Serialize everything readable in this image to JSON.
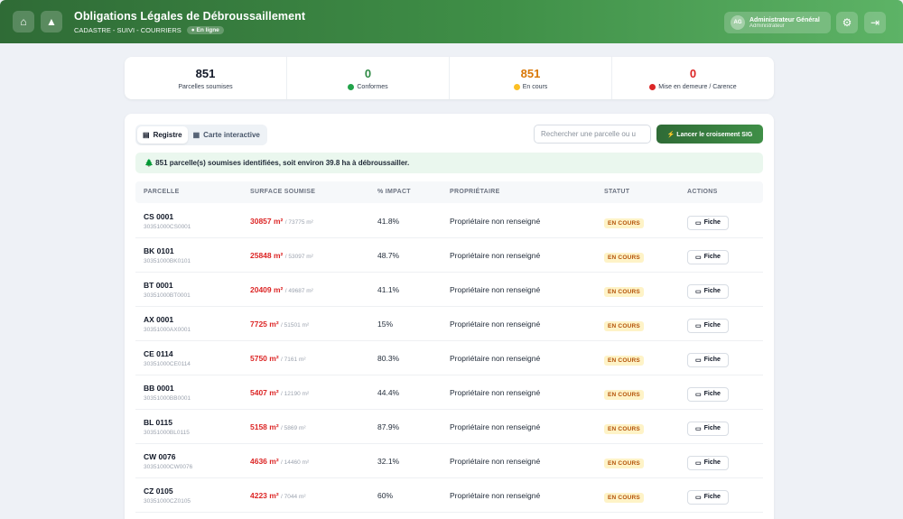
{
  "header": {
    "title": "Obligations Légales de Débroussaillement",
    "subtitle": "CADASTRE - SUIVI - COURRIERS",
    "status": "● En ligne",
    "user_initials": "AG",
    "user_name": "Administrateur Général",
    "user_role": "Administrateur",
    "icons": [
      "home-icon",
      "tree-icon",
      "gear-icon",
      "logout-icon"
    ]
  },
  "stats": [
    {
      "value": "851",
      "label": "Parcelles soumises",
      "color": "#111827",
      "dot": ""
    },
    {
      "value": "0",
      "label": "Conformes",
      "color": "#2f8a45",
      "dot": "#22a34a"
    },
    {
      "value": "851",
      "label": "En cours",
      "color": "#d97706",
      "dot": "#fbbf24"
    },
    {
      "value": "0",
      "label": "Mise en demeure / Carence",
      "color": "#dc2626",
      "dot": "#dc2626"
    }
  ],
  "tabs": {
    "registre": "Registre",
    "carte": "Carte interactive"
  },
  "search": {
    "placeholder": "Rechercher une parcelle ou u"
  },
  "launch_label": "⚡ Lancer le croisement SIG",
  "banner": "🌲 851 parcelle(s) soumises identifiées, soit environ 39.8 ha à débroussailler.",
  "table": {
    "headers": [
      "PARCELLE",
      "SURFACE SOUMISE",
      "% IMPACT",
      "PROPRIÉTAIRE",
      "STATUT",
      "ACTIONS"
    ],
    "rows": [
      {
        "code": "CS 0001",
        "id": "30351000CS0001",
        "surface": "30857 m²",
        "total": "/ 73775 m²",
        "impact": "41.8%",
        "owner": "Propriétaire non renseigné",
        "status": "EN COURS",
        "action": "Fiche"
      },
      {
        "code": "BK 0101",
        "id": "30351000BK0101",
        "surface": "25848 m²",
        "total": "/ 53097 m²",
        "impact": "48.7%",
        "owner": "Propriétaire non renseigné",
        "status": "EN COURS",
        "action": "Fiche"
      },
      {
        "code": "BT 0001",
        "id": "30351000BT0001",
        "surface": "20409 m²",
        "total": "/ 49687 m²",
        "impact": "41.1%",
        "owner": "Propriétaire non renseigné",
        "status": "EN COURS",
        "action": "Fiche"
      },
      {
        "code": "AX 0001",
        "id": "30351000AX0001",
        "surface": "7725 m²",
        "total": "/ 51501 m²",
        "impact": "15%",
        "owner": "Propriétaire non renseigné",
        "status": "EN COURS",
        "action": "Fiche"
      },
      {
        "code": "CE 0114",
        "id": "30351000CE0114",
        "surface": "5750 m²",
        "total": "/ 7161 m²",
        "impact": "80.3%",
        "owner": "Propriétaire non renseigné",
        "status": "EN COURS",
        "action": "Fiche"
      },
      {
        "code": "BB 0001",
        "id": "30351000BB0001",
        "surface": "5407 m²",
        "total": "/ 12190 m²",
        "impact": "44.4%",
        "owner": "Propriétaire non renseigné",
        "status": "EN COURS",
        "action": "Fiche"
      },
      {
        "code": "BL 0115",
        "id": "30351000BL0115",
        "surface": "5158 m²",
        "total": "/ 5869 m²",
        "impact": "87.9%",
        "owner": "Propriétaire non renseigné",
        "status": "EN COURS",
        "action": "Fiche"
      },
      {
        "code": "CW 0076",
        "id": "30351000CW0076",
        "surface": "4636 m²",
        "total": "/ 14460 m²",
        "impact": "32.1%",
        "owner": "Propriétaire non renseigné",
        "status": "EN COURS",
        "action": "Fiche"
      },
      {
        "code": "CZ 0105",
        "id": "30351000CZ0105",
        "surface": "4223 m²",
        "total": "/ 7044 m²",
        "impact": "60%",
        "owner": "Propriétaire non renseigné",
        "status": "EN COURS",
        "action": "Fiche"
      }
    ]
  }
}
